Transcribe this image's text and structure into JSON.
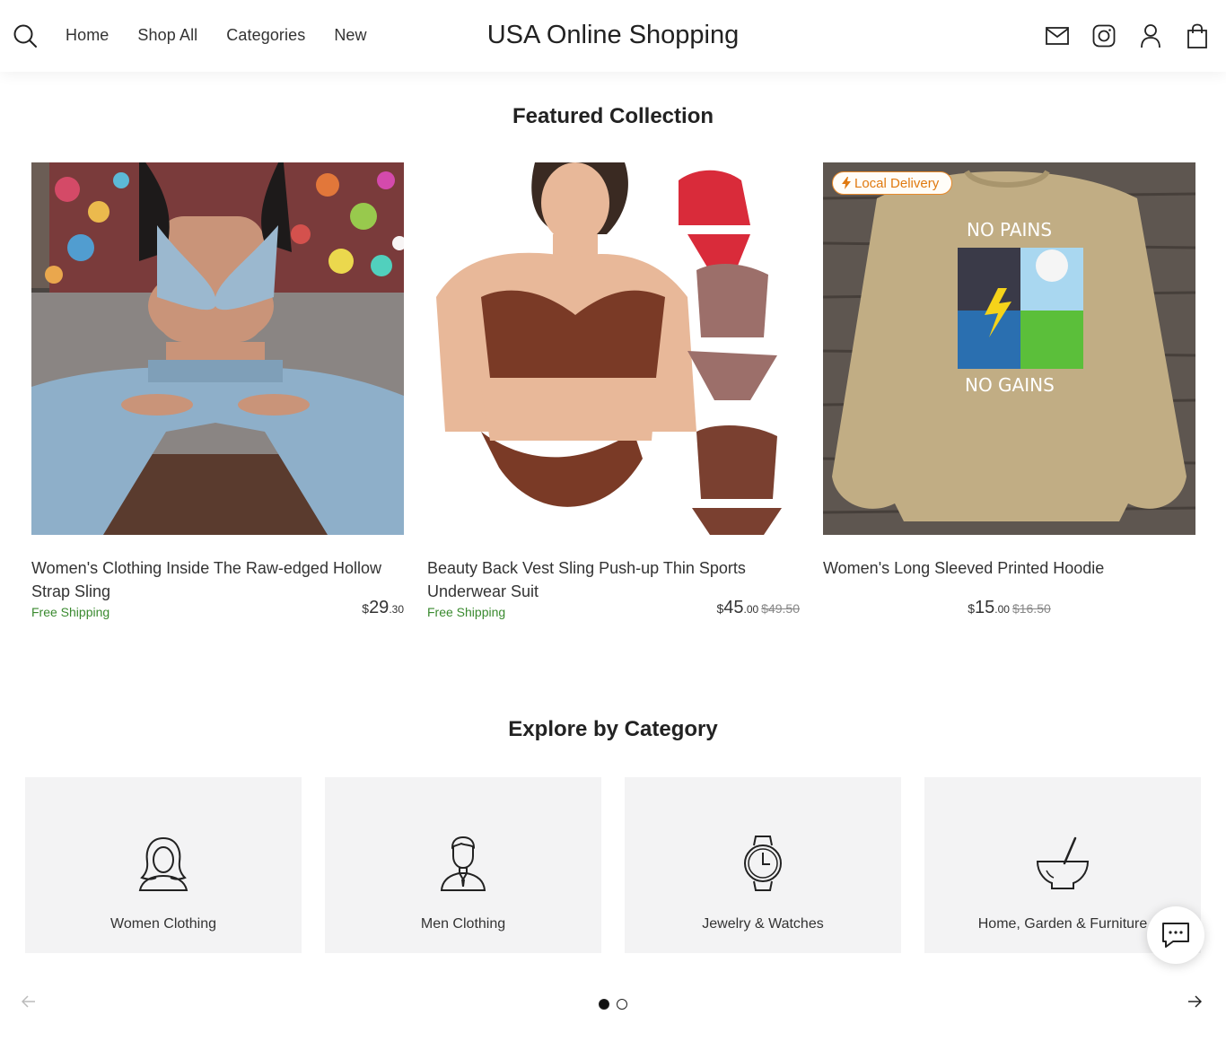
{
  "header": {
    "brand": "USA Online Shopping",
    "nav": [
      "Home",
      "Shop All",
      "Categories",
      "New"
    ],
    "icons": [
      "search-icon",
      "mail-icon",
      "instagram-icon",
      "account-icon",
      "cart-icon"
    ]
  },
  "featured": {
    "title": "Featured Collection",
    "products": [
      {
        "name": "Women's Clothing Inside The Raw-edged Hollow Strap Sling",
        "shipping": "Free Shipping",
        "currency": "$",
        "price_int": "29",
        "price_dec": ".30",
        "old_price": ""
      },
      {
        "name": "Beauty Back Vest Sling Push-up Thin Sports Underwear Suit",
        "shipping": "Free Shipping",
        "currency": "$",
        "price_int": "45",
        "price_dec": ".00",
        "old_price": "$49.50"
      },
      {
        "name": "Women's Long Sleeved Printed Hoodie",
        "shipping": "",
        "currency": "$",
        "price_int": "15",
        "price_dec": ".00",
        "old_price": "$16.50",
        "badge": "Local Delivery",
        "print_top": "NO PAINS",
        "print_bottom": "NO GAINS"
      }
    ]
  },
  "categories": {
    "title": "Explore by Category",
    "items": [
      {
        "label": "Women Clothing",
        "icon": "woman-icon"
      },
      {
        "label": "Men Clothing",
        "icon": "man-icon"
      },
      {
        "label": "Jewelry & Watches",
        "icon": "watch-icon"
      },
      {
        "label": "Home, Garden & Furniture",
        "icon": "mortar-pestle-icon"
      }
    ],
    "pagination": {
      "pages": 2,
      "active": 1
    }
  },
  "colors": {
    "shipping_green": "#3a8a2f",
    "badge_orange": "#e07a10",
    "tile_bg": "#f3f3f4"
  }
}
